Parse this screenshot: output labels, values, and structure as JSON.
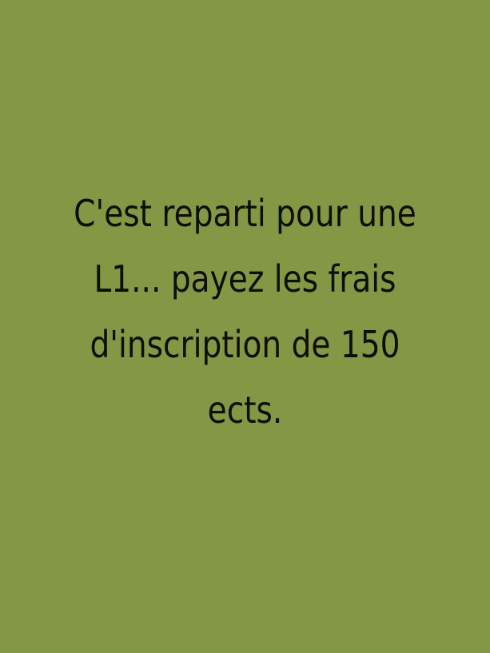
{
  "card": {
    "background_color": "#849745",
    "text_color": "#0b0f05",
    "message_lines": [
      "C'est reparti pour une",
      "L1... payez les frais",
      "d'inscription de 150",
      "ects."
    ]
  }
}
